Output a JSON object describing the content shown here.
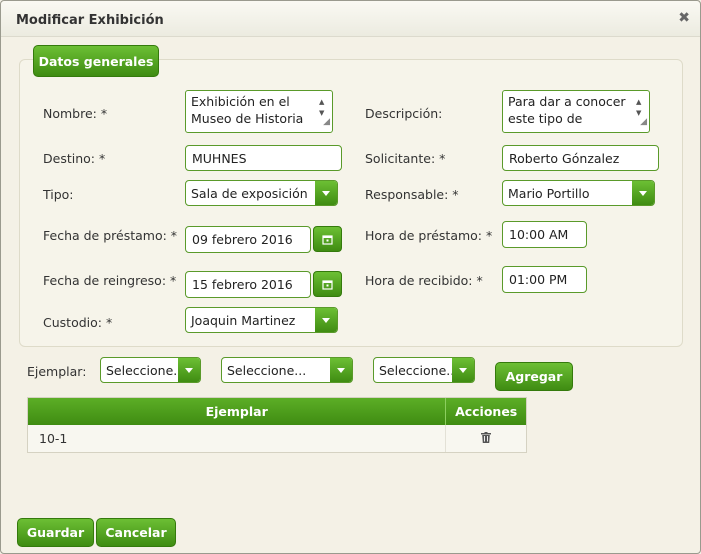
{
  "dialog": {
    "title": "Modificar Exhibición",
    "close_icon": "close-icon"
  },
  "section": {
    "legend": "Datos generales"
  },
  "form": {
    "nombre": {
      "label": "Nombre: *",
      "value_line1": "Exhibición en el",
      "value_line2": "Museo de Historia"
    },
    "descripcion": {
      "label": "Descripción:",
      "value_line1": "Para dar a conocer",
      "value_line2": "este tipo de"
    },
    "destino": {
      "label": "Destino: *",
      "value": "MUHNES"
    },
    "solicitante": {
      "label": "Solicitante: *",
      "value": "Roberto Gónzalez"
    },
    "tipo": {
      "label": "Tipo:",
      "value": "Sala de exposición"
    },
    "responsable": {
      "label": "Responsable: *",
      "value": "Mario Portillo"
    },
    "fecha_prestamo": {
      "label": "Fecha de préstamo: *",
      "value": "09 febrero 2016"
    },
    "hora_prestamo": {
      "label": "Hora de préstamo: *",
      "value": "10:00 AM"
    },
    "fecha_reingreso": {
      "label": "Fecha de reingreso: *",
      "value": "15 febrero 2016"
    },
    "hora_recibido": {
      "label": "Hora de recibido: *",
      "value": "01:00 PM"
    },
    "custodio": {
      "label": "Custodio: *",
      "value": "Joaquin Martinez"
    }
  },
  "ejemplar": {
    "label": "Ejemplar:",
    "select1": "Seleccione...",
    "select2": "Seleccione...",
    "select3": "Seleccione...",
    "add_label": "Agregar"
  },
  "table": {
    "headers": [
      "Ejemplar",
      "Acciones"
    ],
    "rows": [
      {
        "ejemplar": "10-1",
        "action_icon": "trash-icon"
      }
    ]
  },
  "footer": {
    "save_label": "Guardar",
    "cancel_label": "Cancelar"
  },
  "colors": {
    "accent_green": "#4a9c1a",
    "dialog_bg": "#f4f1e6"
  }
}
